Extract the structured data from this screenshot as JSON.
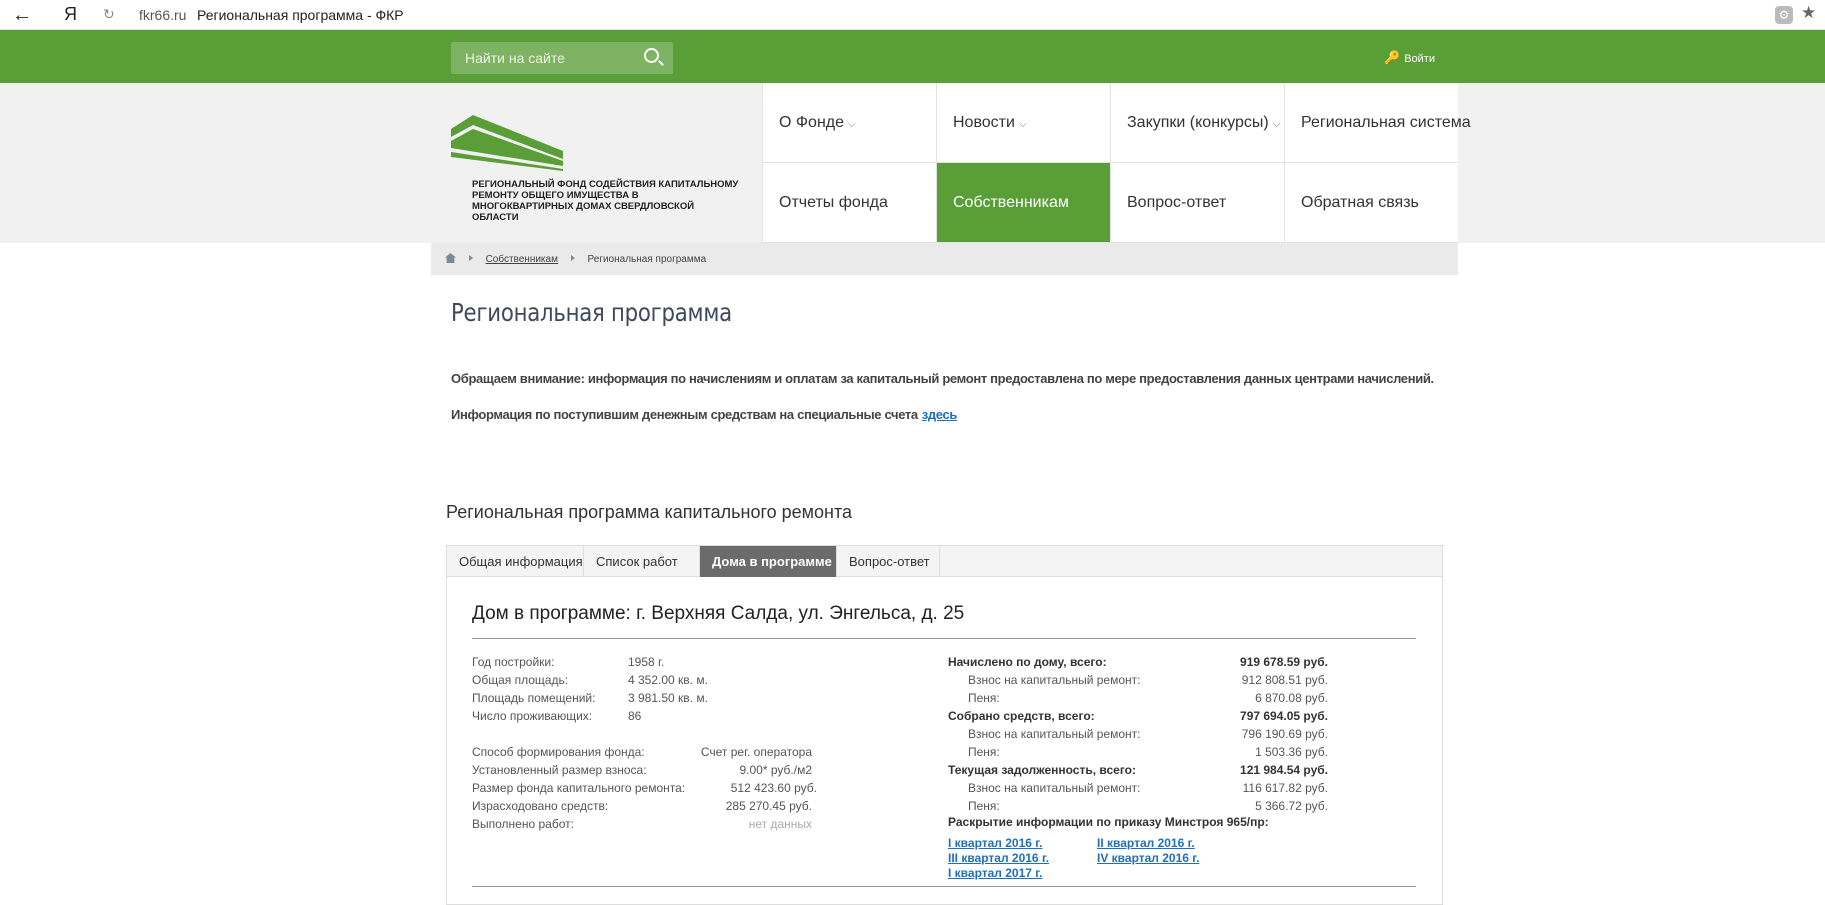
{
  "browser": {
    "domain": "fkr66.ru",
    "page_title": "Региональная программа - ФКР",
    "yandex_label": "Я"
  },
  "topbar": {
    "search_placeholder": "Найти на сайте",
    "login_label": "Войти"
  },
  "logo": {
    "text": "Региональный фонд содействия капитальному ремонту общего имущества в многоквартирных домах Свердловской области"
  },
  "menu": {
    "items": [
      {
        "label": "О Фонде",
        "dropdown": true
      },
      {
        "label": "Новости",
        "dropdown": true
      },
      {
        "label": "Закупки (конкурсы)",
        "dropdown": true
      },
      {
        "label": "Региональная система"
      },
      {
        "label": "Отчеты фонда"
      },
      {
        "label": "Собственникам",
        "active": true
      },
      {
        "label": "Вопрос-ответ"
      },
      {
        "label": "Обратная связь"
      }
    ],
    "chevron": "⌵"
  },
  "breadcrumb": {
    "level1": "Собственникам",
    "current": "Региональная программа"
  },
  "page": {
    "title": "Региональная программа",
    "notice": "Обращаем внимание: информация по начислениям и оплатам за капитальный ремонт предоставлена по мере предоставления данных центрами начислений.",
    "info_text": "Информация по поступившим денежным средствам на  специальные счета",
    "info_link": "здесь"
  },
  "program": {
    "heading": "Региональная программа капитального ремонта",
    "tabs": [
      {
        "label": "Общая информация"
      },
      {
        "label": "Список работ"
      },
      {
        "label": "Дома в программе",
        "active": true
      },
      {
        "label": "Вопрос-ответ"
      }
    ],
    "house_title": "Дом в программе: г. Верхняя Салда, ул. Энгельса, д. 25",
    "general": [
      {
        "label": "Год постройки:",
        "value": "1958 г."
      },
      {
        "label": "Общая площадь:",
        "value": "4 352.00 кв. м."
      },
      {
        "label": "Площадь помещений:",
        "value": "3 981.50 кв. м."
      },
      {
        "label": "Число проживающих:",
        "value": "86"
      }
    ],
    "fund": [
      {
        "label": "Способ формирования фонда:",
        "value": "Счет рег. оператора"
      },
      {
        "label": "Установленный размер взноса:",
        "value": "9.00* руб./м2"
      },
      {
        "label": "Размер фонда капитального ремонта:",
        "value": "512 423.60 руб."
      },
      {
        "label": "Израсходовано средств:",
        "value": "285 270.45 руб."
      },
      {
        "label": "Выполнено работ:",
        "value": "нет данных"
      }
    ],
    "finance": [
      {
        "label": "Начислено по дому, всего:",
        "value": "919 678.59 руб.",
        "bold": true
      },
      {
        "label": "Взнос на капитальный ремонт:",
        "value": "912 808.51 руб."
      },
      {
        "label": "Пеня:",
        "value": "6 870.08 руб."
      },
      {
        "label": "Собрано средств, всего:",
        "value": "797 694.05 руб.",
        "bold": true
      },
      {
        "label": "Взнос на капитальный ремонт:",
        "value": "796 190.69 руб."
      },
      {
        "label": "Пеня:",
        "value": "1 503.36 руб."
      },
      {
        "label": "Текущая задолженность, всего:",
        "value": "121 984.54 руб.",
        "bold": true
      },
      {
        "label": "Взнос на капитальный ремонт:",
        "value": "116 617.82 руб."
      },
      {
        "label": "Пеня:",
        "value": "5 366.72 руб."
      }
    ],
    "disclosure_heading": "Раскрытие информации по приказу Минстроя 965/пр:",
    "quarters": [
      "I квартал 2016 г.",
      "II квартал 2016 г.",
      "III квартал 2016 г.",
      "IV квартал 2016 г.",
      "I квартал 2017 г."
    ]
  }
}
